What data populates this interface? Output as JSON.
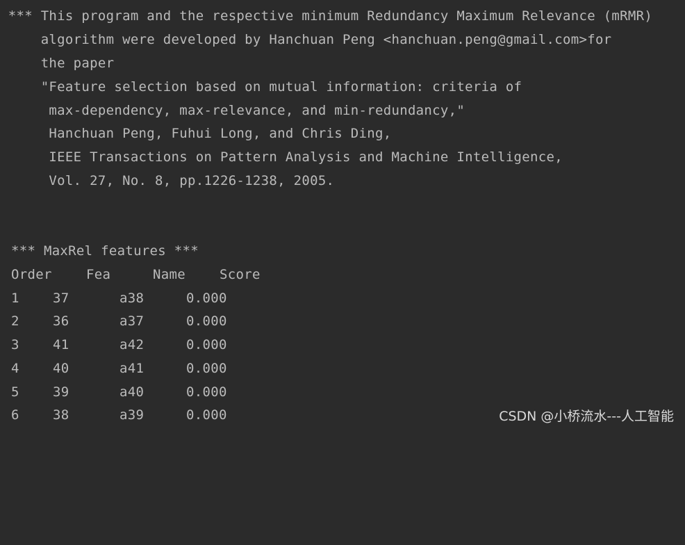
{
  "console": {
    "header_lines": [
      " *** This program and the respective minimum Redundancy Maximum Relevance (mRMR)",
      "     algorithm were developed by Hanchuan Peng <hanchuan.peng@gmail.com>for",
      "     the paper",
      "     \"Feature selection based on mutual information: criteria of",
      "      max-dependency, max-relevance, and min-redundancy,\"",
      "      Hanchuan Peng, Fuhui Long, and Chris Ding,",
      "      IEEE Transactions on Pattern Analysis and Machine Intelligence,",
      "      Vol. 27, No. 8, pp.1226-1238, 2005."
    ],
    "section_title": "*** MaxRel features ***",
    "table": {
      "columns": [
        "Order",
        "Fea",
        "Name",
        "Score"
      ],
      "rows": [
        [
          "1",
          "37",
          "a38",
          "0.000"
        ],
        [
          "2",
          "36",
          "a37",
          "0.000"
        ],
        [
          "3",
          "41",
          "a42",
          "0.000"
        ],
        [
          "4",
          "40",
          "a41",
          "0.000"
        ],
        [
          "5",
          "39",
          "a40",
          "0.000"
        ],
        [
          "6",
          "38",
          "a39",
          "0.000"
        ]
      ]
    }
  },
  "watermark": "CSDN @小桥流水---人工智能",
  "colors": {
    "background": "#2b2b2b",
    "text": "#bbbbbb"
  }
}
